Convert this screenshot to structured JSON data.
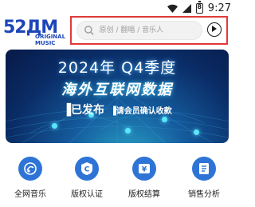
{
  "status_bar": {
    "time": "9:27",
    "battery_level": "8"
  },
  "logo": {
    "big": "52ДM",
    "small": "ORIGINAL MUSIC"
  },
  "search": {
    "placeholder": "原创 / 翻唱 / 音乐人"
  },
  "banner": {
    "line1": "2024年 Q4季度",
    "line2": "海外互联网数据",
    "line3_highlight": "▐已发布",
    "line3_rest": "▐请会员确认收款"
  },
  "nav": [
    {
      "label": "全网音乐",
      "icon": "music-globe-icon"
    },
    {
      "label": "版权认证",
      "icon": "copyright-badge-icon"
    },
    {
      "label": "版权结算",
      "icon": "yen-settlement-icon"
    },
    {
      "label": "销售分析",
      "icon": "sales-report-icon"
    }
  ],
  "colors": {
    "brand": "#1d46b8",
    "nav_icon_bg": "#2e74d6",
    "highlight": "#e03a3a"
  }
}
